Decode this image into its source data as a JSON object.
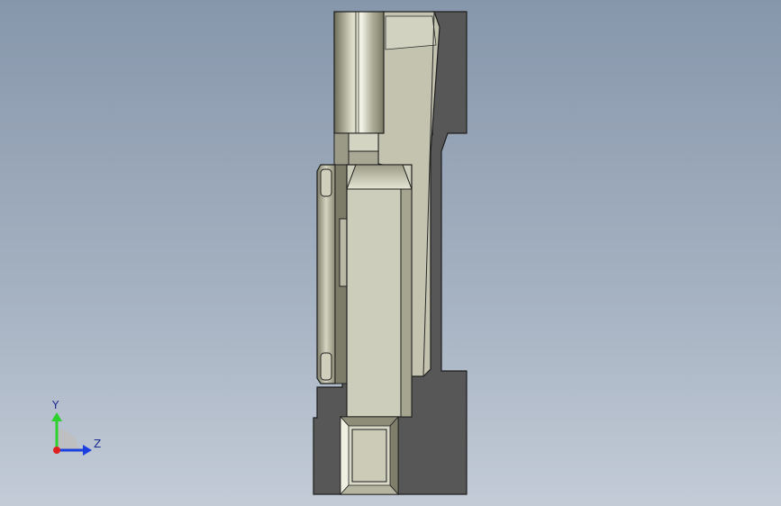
{
  "viewport": {
    "background_top": "#8797ab",
    "background_bottom": "#c3cbd7"
  },
  "model": {
    "face_light": "#cfcfbd",
    "face_mid": "#b5b5a2",
    "face_dark": "#555555",
    "edge": "#1e1e1e"
  },
  "triad": {
    "y_label": "Y",
    "z_label": "Z",
    "y_color": "#2fd12f",
    "z_color": "#1c3fe0",
    "x_color": "#e02020"
  }
}
